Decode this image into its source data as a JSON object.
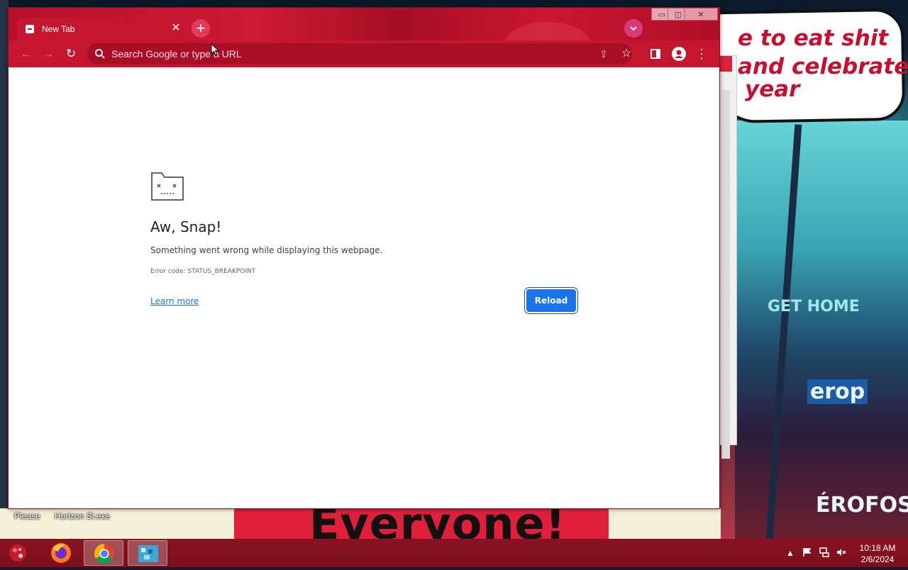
{
  "desktop": {
    "wallpaper_lines": [
      "e to eat shit",
      "and celebrate",
      "year"
    ],
    "wallpaper_banner": "Everyone!",
    "wallpaper_sign1": "GET HOME",
    "wallpaper_sign2": "erop",
    "wallpaper_sign3": "ÉROFOS",
    "icons": [
      {
        "label": "Please"
      },
      {
        "label": "Horizon Sl.exe"
      }
    ]
  },
  "browser": {
    "tab": {
      "title": "New Tab",
      "close_glyph": "✕"
    },
    "new_tab_glyph": "+",
    "tab_search_glyph": "⌄",
    "window_controls": {
      "minimize": "▭",
      "maximize": "◫",
      "close": "✕"
    },
    "toolbar": {
      "back": "←",
      "forward": "→",
      "reload": "↻",
      "omnibox_placeholder": "Search Google or type a URL",
      "share": "⇪",
      "bookmark": "☆",
      "menu": "⋮"
    }
  },
  "page": {
    "title": "Aw, Snap!",
    "description": "Something went wrong while displaying this webpage.",
    "error_code": "Error code: STATUS_BREAKPOINT",
    "learn_more": "Learn more",
    "reload": "Reload"
  },
  "taskbar": {
    "apps": [
      "firefox-icon",
      "chrome-icon",
      "horizon-app-icon"
    ],
    "clock": {
      "time": "10:18 AM",
      "date": "2/6/2024"
    },
    "tray": {
      "overflow": "▲"
    }
  },
  "colors": {
    "theme_red": "#c5162f",
    "reload_blue": "#1a73e8",
    "link_blue": "#1a73e8",
    "taskbar": "#7a0f1c"
  }
}
